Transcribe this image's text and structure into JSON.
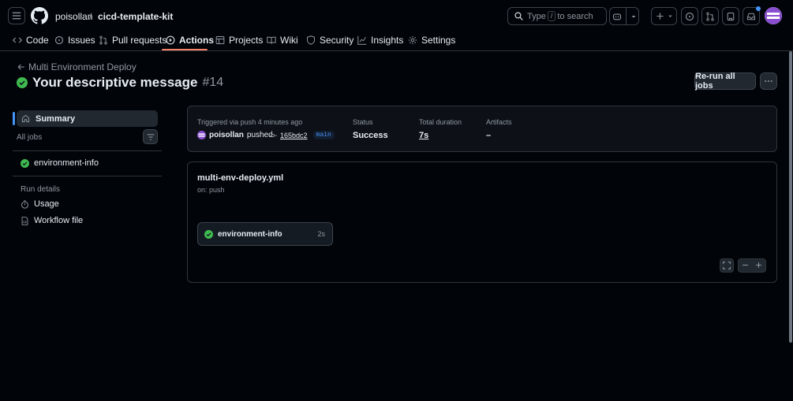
{
  "header": {
    "owner": "poisollan",
    "separator": "/",
    "repo": "cicd-template-kit",
    "search_placeholder_pre": "Type",
    "search_key": "/",
    "search_placeholder_post": "to search"
  },
  "tabs": [
    {
      "label": "Code",
      "icon": "code-icon"
    },
    {
      "label": "Issues",
      "icon": "issue-icon"
    },
    {
      "label": "Pull requests",
      "icon": "pull-request-icon"
    },
    {
      "label": "Actions",
      "icon": "play-icon"
    },
    {
      "label": "Projects",
      "icon": "table-icon"
    },
    {
      "label": "Wiki",
      "icon": "book-icon"
    },
    {
      "label": "Security",
      "icon": "shield-icon"
    },
    {
      "label": "Insights",
      "icon": "graph-icon"
    },
    {
      "label": "Settings",
      "icon": "gear-icon"
    }
  ],
  "run": {
    "back_label": "Multi Environment Deploy",
    "title": "Your descriptive message",
    "number": "#14",
    "rerun_label": "Re-run all jobs"
  },
  "sidebar": {
    "summary": "Summary",
    "all_jobs": "All jobs",
    "job": "environment-info",
    "run_details": "Run details",
    "usage": "Usage",
    "workflow_file": "Workflow file"
  },
  "summary_card": {
    "trigger": "Triggered via push 4 minutes ago",
    "actor": "poisollan",
    "action": "pushed",
    "sha": "165bdc2",
    "branch": "main",
    "status_label": "Status",
    "status_value": "Success",
    "duration_label": "Total duration",
    "duration_value": "7s",
    "artifacts_label": "Artifacts",
    "artifacts_value": "–"
  },
  "graph": {
    "file": "multi-env-deploy.yml",
    "on": "on: push",
    "job_name": "environment-info",
    "job_duration": "2s"
  },
  "colors": {
    "success": "#3fb950",
    "accent": "#4493f8",
    "tab_underline": "#f78166"
  }
}
